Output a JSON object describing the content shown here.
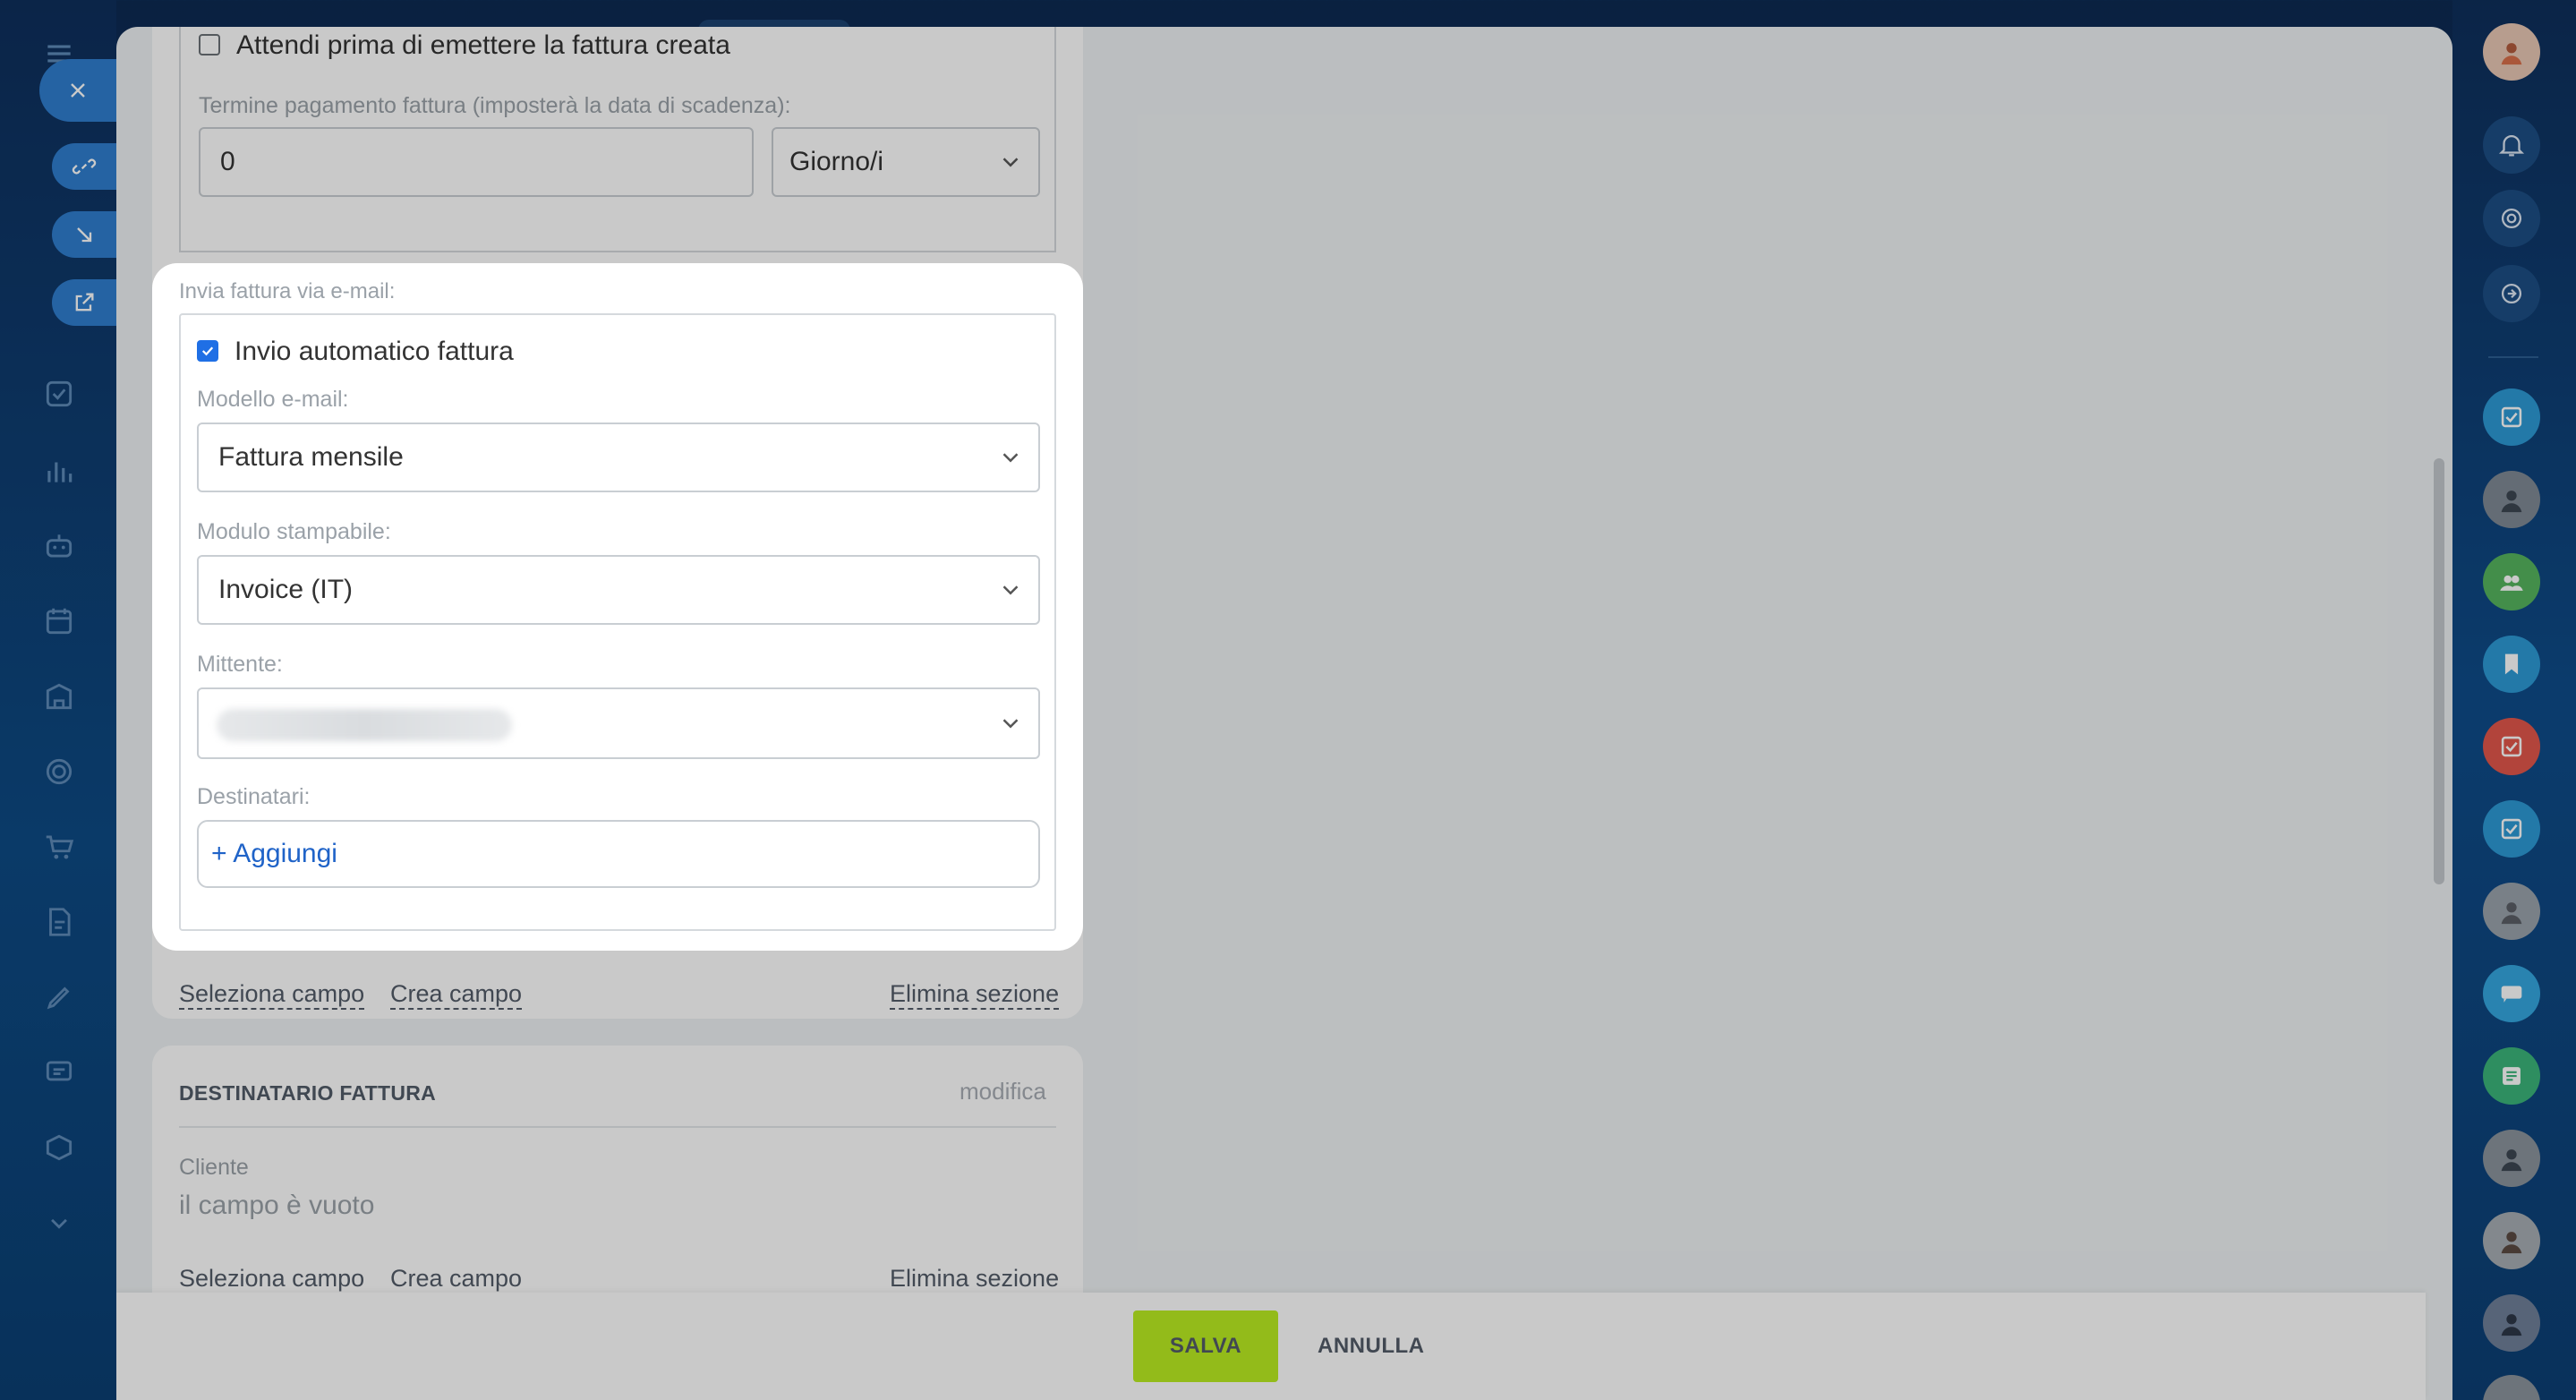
{
  "sidebar": {
    "close_label": "×"
  },
  "top_section": {
    "wait_checkbox_label": "Attendi prima di emettere la fattura creata",
    "wait_checked": false,
    "payment_term_label": "Termine pagamento fattura (imposterà la data di scadenza):",
    "payment_term_value": "0",
    "payment_term_unit": "Giorno/i"
  },
  "email_section": {
    "section_label": "Invia fattura via e-mail:",
    "auto_send_label": "Invio automatico fattura",
    "auto_send_checked": true,
    "template_label": "Modello e-mail:",
    "template_value": "Fattura mensile",
    "print_form_label": "Modulo stampabile:",
    "print_form_value": "Invoice (IT)",
    "sender_label": "Mittente:",
    "recipients_label": "Destinatari:",
    "add_label": "+ Aggiungi"
  },
  "section_actions": {
    "select_field": "Seleziona campo",
    "create_field": "Crea campo",
    "delete_section": "Elimina sezione"
  },
  "invoice_recipient": {
    "title": "DESTINATARIO FATTURA",
    "modify": "modifica",
    "client_label": "Cliente",
    "client_value": "il campo è vuoto"
  },
  "footer": {
    "save": "SALVA",
    "cancel": "ANNULLA"
  },
  "colors": {
    "accent_blue": "#2f7ecf",
    "save_green": "#bbed21",
    "link_blue": "#1f63c8",
    "checkbox_blue": "#1f6fe5"
  }
}
